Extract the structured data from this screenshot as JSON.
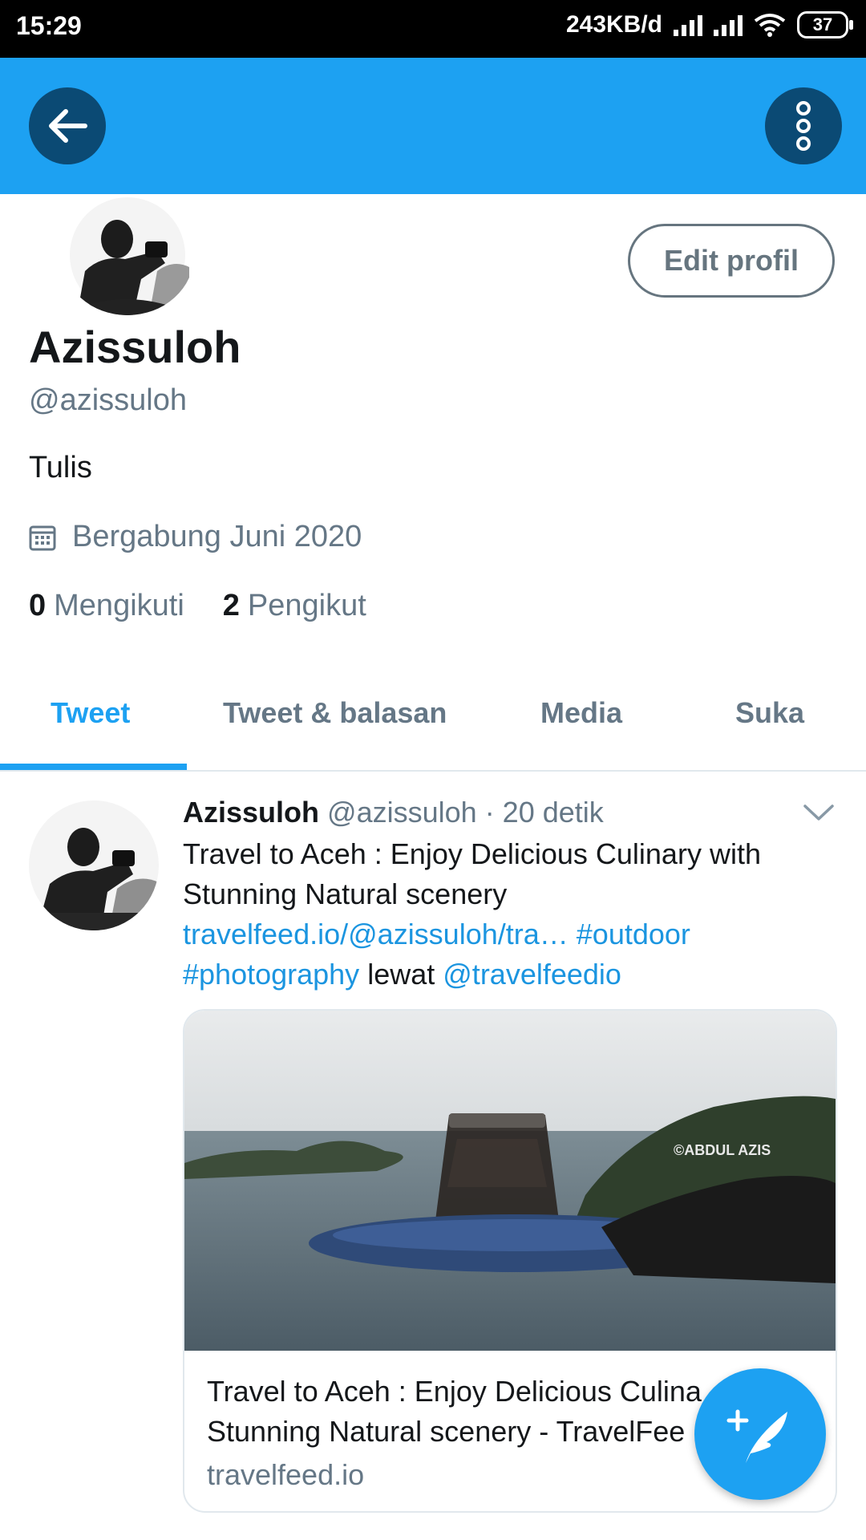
{
  "status_bar": {
    "time": "15:29",
    "network_speed": "243KB/d",
    "battery": "37"
  },
  "profile": {
    "edit_label": "Edit profil",
    "name": "Azissuloh",
    "handle": "@azissuloh",
    "bio": "Tulis",
    "joined": "Bergabung Juni 2020",
    "following_count": "0",
    "following_label": "Mengikuti",
    "followers_count": "2",
    "followers_label": "Pengikut"
  },
  "tabs": [
    {
      "label": "Tweet",
      "active": true
    },
    {
      "label": "Tweet & balasan",
      "active": false
    },
    {
      "label": "Media",
      "active": false
    },
    {
      "label": "Suka",
      "active": false
    }
  ],
  "tweet": {
    "author": "Azissuloh",
    "handle": "@azissuloh",
    "time": "· 20 detik",
    "text_line1": "Travel to Aceh : Enjoy Delicious Culinary with",
    "text_line2": "Stunning Natural scenery",
    "link_url": "travelfeed.io/@azissuloh/tra…",
    "hashtag1": "#outdoor",
    "hashtag2": "#photography",
    "via_word": "lewat",
    "mention": "@travelfeedio",
    "card": {
      "watermark": "©ABDUL AZIS",
      "title_line1": "Travel to Aceh : Enjoy Delicious Culina",
      "title_line2": "Stunning Natural scenery - TravelFee",
      "domain": "travelfeed.io"
    }
  },
  "colors": {
    "brand_blue": "#1da1f2",
    "dark_button": "#0b4a74",
    "secondary_text": "#657786",
    "link": "#1b95e0"
  },
  "icons": [
    "back-arrow-icon",
    "more-vertical-icon",
    "calendar-icon",
    "chevron-down-icon",
    "compose-tweet-icon"
  ]
}
